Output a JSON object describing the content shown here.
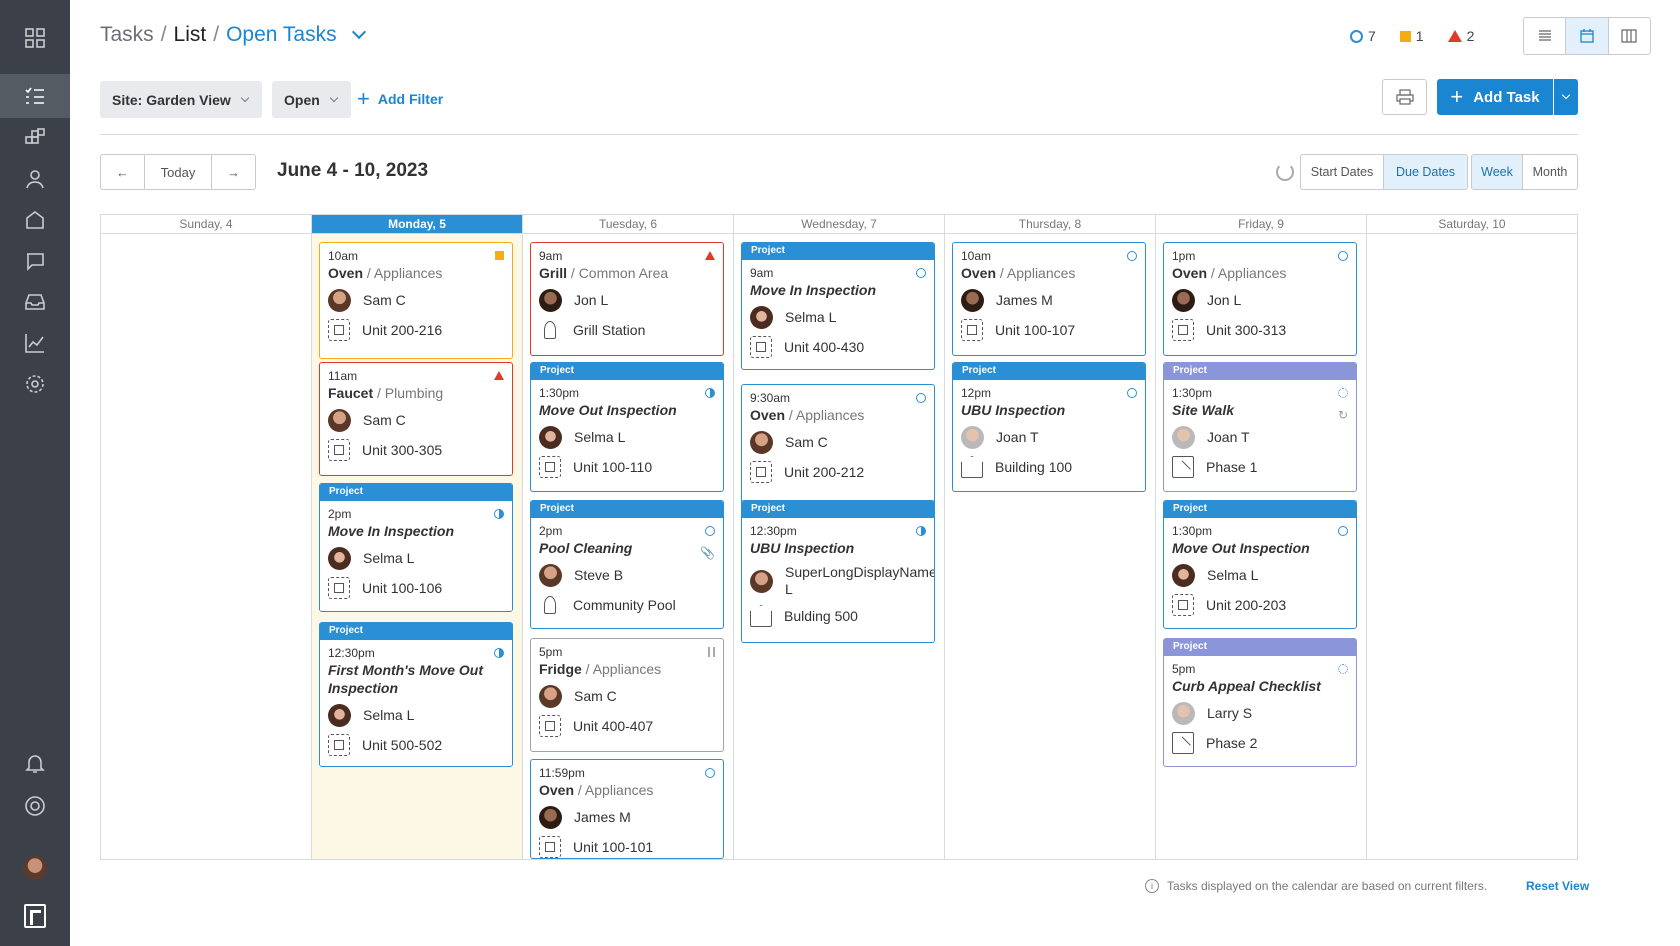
{
  "breadcrumb": {
    "tasks": "Tasks",
    "list": "List",
    "view": "Open Tasks",
    "sep": "/"
  },
  "counts": {
    "open": "7",
    "medium": "1",
    "high": "2"
  },
  "filters": {
    "site": "Site: Garden View",
    "status": "Open",
    "add": "Add Filter"
  },
  "add_task_label": "Add Task",
  "nav": {
    "today": "Today",
    "date_range": "June 4 - 10, 2023"
  },
  "date_mode": {
    "start": "Start Dates",
    "due": "Due Dates"
  },
  "range_mode": {
    "week": "Week",
    "month": "Month"
  },
  "days": [
    "Sunday, 4",
    "Monday, 5",
    "Tuesday, 6",
    "Wednesday, 7",
    "Thursday, 8",
    "Friday, 9",
    "Saturday, 10"
  ],
  "project_tag": "Project",
  "cards": [
    {
      "day": 1,
      "time": "10am",
      "title": "Oven",
      "cat": "Appliances",
      "person": "Sam C",
      "loc": "Unit 200-216",
      "status": "square",
      "color": "yel"
    },
    {
      "day": 1,
      "time": "11am",
      "title": "Faucet",
      "cat": "Plumbing",
      "person": "Sam C",
      "loc": "Unit 300-305",
      "status": "tri",
      "color": "red"
    },
    {
      "day": 1,
      "project": true,
      "time": "2pm",
      "title": "Move In Inspection",
      "person": "Selma L",
      "loc": "Unit 100-106",
      "status": "half"
    },
    {
      "day": 1,
      "project": true,
      "time": "12:30pm",
      "title": "First Month's Move Out Inspection",
      "person": "Selma L",
      "loc": "Unit 500-502",
      "status": "half"
    },
    {
      "day": 2,
      "time": "9am",
      "title": "Grill",
      "cat": "Common Area",
      "person": "Jon L",
      "loc": "Grill Station",
      "status": "tri",
      "color": "red",
      "loctype": "amen"
    },
    {
      "day": 2,
      "project": true,
      "time": "1:30pm",
      "title": "Move Out Inspection",
      "person": "Selma L",
      "loc": "Unit 100-110",
      "status": "half"
    },
    {
      "day": 2,
      "project": true,
      "time": "2pm",
      "title": "Pool Cleaning",
      "person": "Steve B",
      "loc": "Community Pool",
      "status": "circle",
      "loctype": "amen",
      "extra": "📎"
    },
    {
      "day": 2,
      "time": "5pm",
      "title": "Fridge",
      "cat": "Appliances",
      "person": "Sam C",
      "loc": "Unit 400-407",
      "status": "pause",
      "color": "gray"
    },
    {
      "day": 2,
      "time": "11:59pm",
      "title": "Oven",
      "cat": "Appliances",
      "person": "James M",
      "loc": "Unit 100-101",
      "status": "circle"
    },
    {
      "day": 3,
      "project": true,
      "time": "9am",
      "title": "Move In Inspection",
      "person": "Selma L",
      "loc": "Unit 400-430",
      "status": "circle"
    },
    {
      "day": 3,
      "time": "9:30am",
      "title": "Oven",
      "cat": "Appliances",
      "person": "Sam C",
      "loc": "Unit 200-212",
      "status": "circle"
    },
    {
      "day": 3,
      "project": true,
      "time": "12:30pm",
      "title": "UBU Inspection",
      "person": "SuperLongDisplayName L",
      "loc": "Bulding 500",
      "status": "half",
      "loctype": "bld"
    },
    {
      "day": 4,
      "time": "10am",
      "title": "Oven",
      "cat": "Appliances",
      "person": "James M",
      "loc": "Unit 100-107",
      "status": "circle"
    },
    {
      "day": 4,
      "project": true,
      "time": "12pm",
      "title": "UBU Inspection",
      "person": "Joan T",
      "loc": "Building 100",
      "status": "circle",
      "loctype": "bld"
    },
    {
      "day": 5,
      "time": "1pm",
      "title": "Oven",
      "cat": "Appliances",
      "person": "Jon L",
      "loc": "Unit 300-313",
      "status": "circle"
    },
    {
      "day": 5,
      "project": true,
      "time": "1:30pm",
      "title": "Site Walk",
      "person": "Joan T",
      "loc": "Phase 1",
      "status": "dot",
      "color": "pur",
      "loctype": "ph",
      "extra": "↻"
    },
    {
      "day": 5,
      "project": true,
      "time": "1:30pm",
      "title": "Move Out Inspection",
      "person": "Selma L",
      "loc": "Unit 200-203",
      "status": "circle"
    },
    {
      "day": 5,
      "project": true,
      "time": "5pm",
      "title": "Curb Appeal Checklist",
      "person": "Larry S",
      "loc": "Phase 2",
      "status": "dot",
      "color": "pur",
      "loctype": "ph"
    }
  ],
  "footer": {
    "note": "Tasks displayed on the calendar are based on current filters.",
    "reset": "Reset View"
  }
}
